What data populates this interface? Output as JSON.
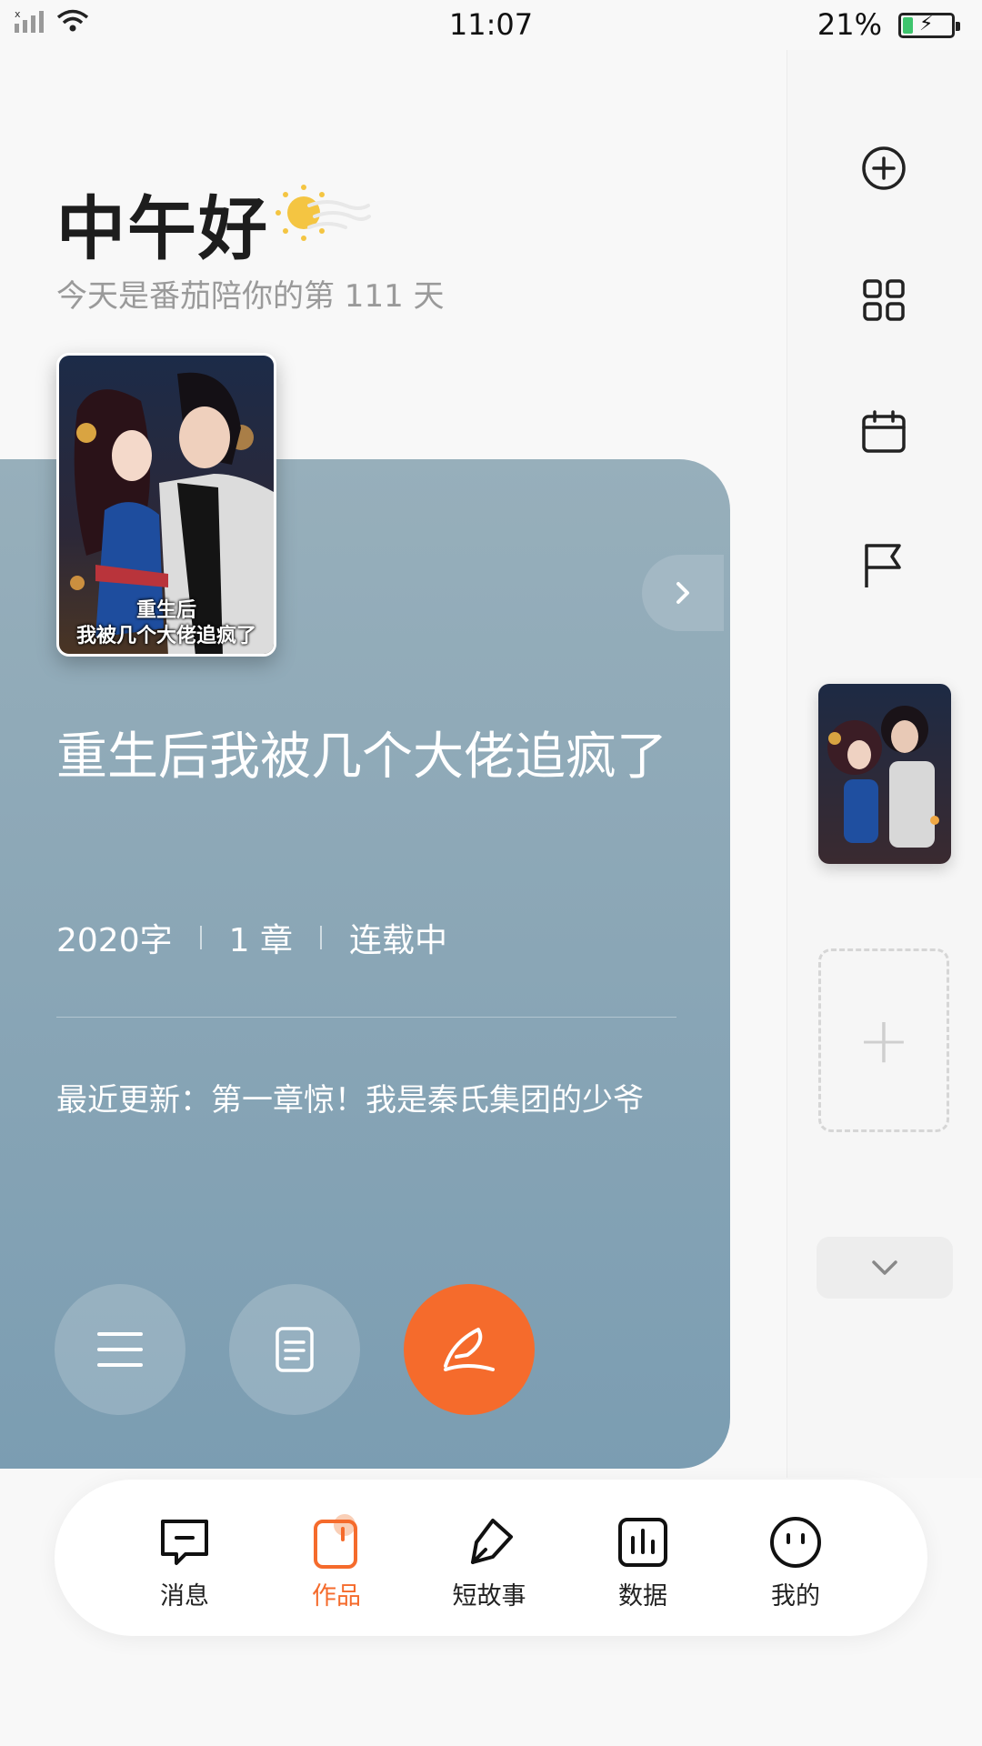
{
  "status_bar": {
    "time": "11:07",
    "battery": "21%",
    "battery_level": 0.21
  },
  "greeting": {
    "title": "中午好",
    "subtitle": "今天是番茄陪你的第 111 天",
    "weather_icon": "sun-icon"
  },
  "book": {
    "cover_title_line1": "重生后",
    "cover_title_line2": "我被几个大佬追疯了",
    "title": "重生后我被几个大佬追疯了",
    "word_count": "2020字",
    "chapters": "1 章",
    "status": "连载中",
    "latest_update": "最近更新：第一章惊！我是秦氏集团的少爷"
  },
  "rail": {
    "items": [
      "add-circle-icon",
      "grid-icon",
      "calendar-icon",
      "flag-icon"
    ],
    "add_symbol": "+"
  },
  "actions": [
    "menu-icon",
    "document-icon",
    "quill-icon"
  ],
  "colors": {
    "accent": "#f56b2c",
    "card": "#8aa6b6",
    "battery": "#3ec46d"
  },
  "nav": [
    {
      "label": "消息",
      "icon": "message-icon"
    },
    {
      "label": "作品",
      "icon": "works-icon",
      "active": true
    },
    {
      "label": "短故事",
      "icon": "pen-icon"
    },
    {
      "label": "数据",
      "icon": "chart-icon"
    },
    {
      "label": "我的",
      "icon": "face-icon"
    }
  ]
}
